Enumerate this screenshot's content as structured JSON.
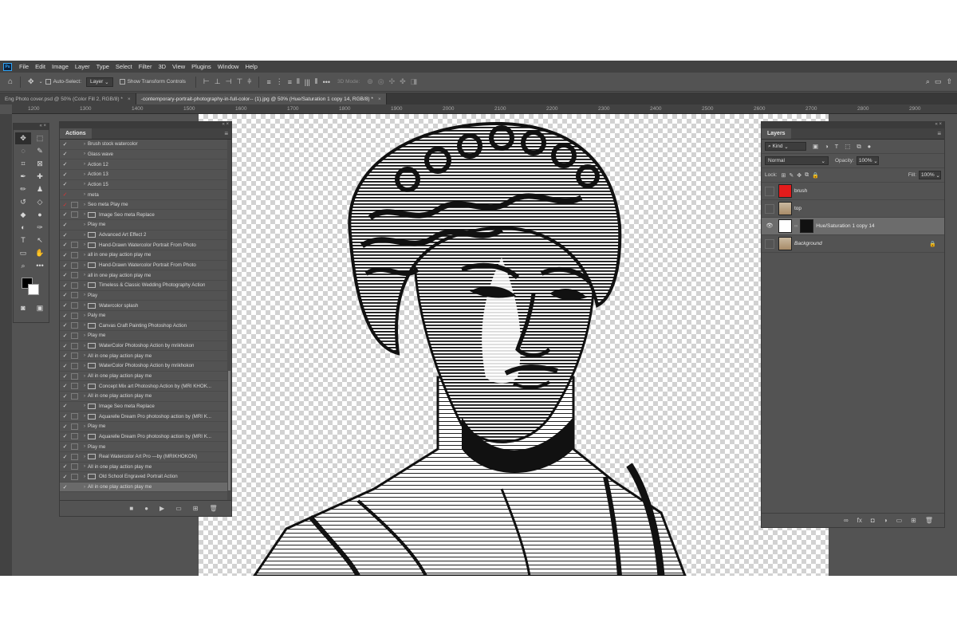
{
  "app": {
    "logo": "Ps"
  },
  "menu": [
    "File",
    "Edit",
    "Image",
    "Layer",
    "Type",
    "Select",
    "Filter",
    "3D",
    "View",
    "Plugins",
    "Window",
    "Help"
  ],
  "options": {
    "auto_select_label": "Auto-Select:",
    "auto_select_value": "Layer",
    "show_transform_label": "Show Transform Controls",
    "mode_label": "3D Mode:"
  },
  "tabs": [
    {
      "label": "Eng Photo cover.psd @ 50% (Color Fill 2, RGB/8) *",
      "close": "×"
    },
    {
      "label": "-contemporary-portrait-photography-in-full-color-- (1).jpg @ 50% (Hue/Saturation 1 copy 14, RGB/8) *",
      "close": "×"
    }
  ],
  "ruler": [
    "1200",
    "1300",
    "1400",
    "1500",
    "1600",
    "1700",
    "1800",
    "1900",
    "2000",
    "2100",
    "2200",
    "2300",
    "2400",
    "2500",
    "2600",
    "2700",
    "2800",
    "2900"
  ],
  "actions_panel": {
    "title": "Actions",
    "rows": [
      {
        "check": "✓",
        "dialog": false,
        "folder": false,
        "label": "Brush stock watercolor"
      },
      {
        "check": "✓",
        "dialog": false,
        "folder": false,
        "label": "Glass wave"
      },
      {
        "check": "✓",
        "dialog": false,
        "folder": false,
        "label": "Action 12"
      },
      {
        "check": "✓",
        "dialog": false,
        "folder": false,
        "label": "Action 13"
      },
      {
        "check": "✓",
        "dialog": false,
        "folder": false,
        "label": "Action 15"
      },
      {
        "check": "✓",
        "red": true,
        "dialog": false,
        "folder": false,
        "label": "meta"
      },
      {
        "check": "✓",
        "red": true,
        "dialog": true,
        "folder": false,
        "label": "Seo meta Play me"
      },
      {
        "check": "✓",
        "dialog": true,
        "folder": true,
        "label": "Image Seo meta Replace"
      },
      {
        "check": "✓",
        "dialog": false,
        "folder": false,
        "label": "Play me"
      },
      {
        "check": "✓",
        "dialog": false,
        "folder": true,
        "label": "Advanced Art Effect 2"
      },
      {
        "check": "✓",
        "dialog": true,
        "folder": true,
        "label": "Hand-Drawn Watercolor Portrait From Photo"
      },
      {
        "check": "✓",
        "dialog": true,
        "folder": false,
        "label": "all in one play action play me"
      },
      {
        "check": "✓",
        "dialog": true,
        "folder": true,
        "label": "Hand-Drawn Watercolor Portrait From Photo"
      },
      {
        "check": "✓",
        "dialog": true,
        "folder": false,
        "label": "all in one play action play me"
      },
      {
        "check": "✓",
        "dialog": true,
        "folder": true,
        "label": "Timeless & Classic Wedding Photography Action"
      },
      {
        "check": "✓",
        "dialog": true,
        "folder": false,
        "label": "Play"
      },
      {
        "check": "✓",
        "dialog": true,
        "folder": true,
        "label": "Watercolor splash"
      },
      {
        "check": "✓",
        "dialog": true,
        "folder": false,
        "label": "Paly me"
      },
      {
        "check": "✓",
        "dialog": true,
        "folder": true,
        "label": "Canvas Craft Painting Photoshop Action"
      },
      {
        "check": "✓",
        "dialog": true,
        "folder": false,
        "label": "Play me"
      },
      {
        "check": "✓",
        "dialog": true,
        "folder": true,
        "label": "WaterColor Photoshop Action by mrikhokon"
      },
      {
        "check": "✓",
        "dialog": true,
        "folder": false,
        "label": "All in one play action play me"
      },
      {
        "check": "✓",
        "dialog": true,
        "folder": true,
        "label": "WaterColor Photoshop Action by mrikhokon"
      },
      {
        "check": "✓",
        "dialog": true,
        "folder": false,
        "label": "All in one play action play me"
      },
      {
        "check": "✓",
        "dialog": true,
        "folder": true,
        "label": "Concept Mix art Photoshop Action by (MRI KHOK..."
      },
      {
        "check": "✓",
        "dialog": true,
        "folder": false,
        "label": "All in one play action play me"
      },
      {
        "check": "✓",
        "dialog": false,
        "folder": true,
        "label": "Image Seo meta Replace"
      },
      {
        "check": "✓",
        "dialog": true,
        "folder": true,
        "label": "Aquarelle Dream Pro photoshop action by (MRI K..."
      },
      {
        "check": "✓",
        "dialog": true,
        "folder": false,
        "label": "Play me"
      },
      {
        "check": "✓",
        "dialog": true,
        "folder": true,
        "label": "Aquarelle Dream Pro photoshop action by (MRI K..."
      },
      {
        "check": "✓",
        "dialog": true,
        "folder": false,
        "label": "Play me"
      },
      {
        "check": "✓",
        "dialog": true,
        "folder": true,
        "label": "Real Watercolor Art Pro —by (MRIKHOKON)"
      },
      {
        "check": "✓",
        "dialog": true,
        "folder": false,
        "label": "All in one play action play me"
      },
      {
        "check": "✓",
        "dialog": true,
        "folder": true,
        "label": "Old School Engraved Portrait Action"
      },
      {
        "check": "✓",
        "dialog": false,
        "folder": false,
        "label": "All in one play action play me",
        "selected": true
      }
    ]
  },
  "layers_panel": {
    "title": "Layers",
    "kind_label": "Kind",
    "blend_mode": "Normal",
    "opacity_label": "Opacity:",
    "opacity_value": "100%",
    "lock_label": "Lock:",
    "fill_label": "Fill:",
    "fill_value": "100%",
    "layers": [
      {
        "name": "brush",
        "visible": false,
        "thumb": "red",
        "selected": false
      },
      {
        "name": "top",
        "visible": false,
        "thumb": "face",
        "selected": false
      },
      {
        "name": "Hue/Saturation 1 copy 14",
        "visible": true,
        "thumb": "adj",
        "mask": true,
        "selected": true
      },
      {
        "name": "Background",
        "visible": false,
        "thumb": "face",
        "selected": false,
        "italic": true,
        "locked": true
      }
    ]
  }
}
